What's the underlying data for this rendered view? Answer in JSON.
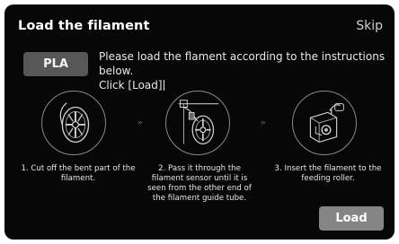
{
  "header": {
    "title": "Load the filament",
    "skip_label": "Skip"
  },
  "material_button": {
    "label": "PLA"
  },
  "instruction": {
    "line1": "Please load the flament according to the instructions below.",
    "line2": "Click [Load]"
  },
  "steps": [
    {
      "icon": "filament-spool-icon",
      "text": "1. Cut off the bent part  of the filament."
    },
    {
      "icon": "filament-sensor-icon",
      "text": "2. Pass it through the filament sensor until it is seen from the other end of the filament guide tube."
    },
    {
      "icon": "feeding-roller-icon",
      "text": "3. Insert the filament to the feeding roller."
    }
  ],
  "step_separator": "››",
  "load_button": {
    "label": "Load"
  },
  "colors": {
    "background": "#070707",
    "button": "#575757",
    "load_button": "#858585"
  }
}
